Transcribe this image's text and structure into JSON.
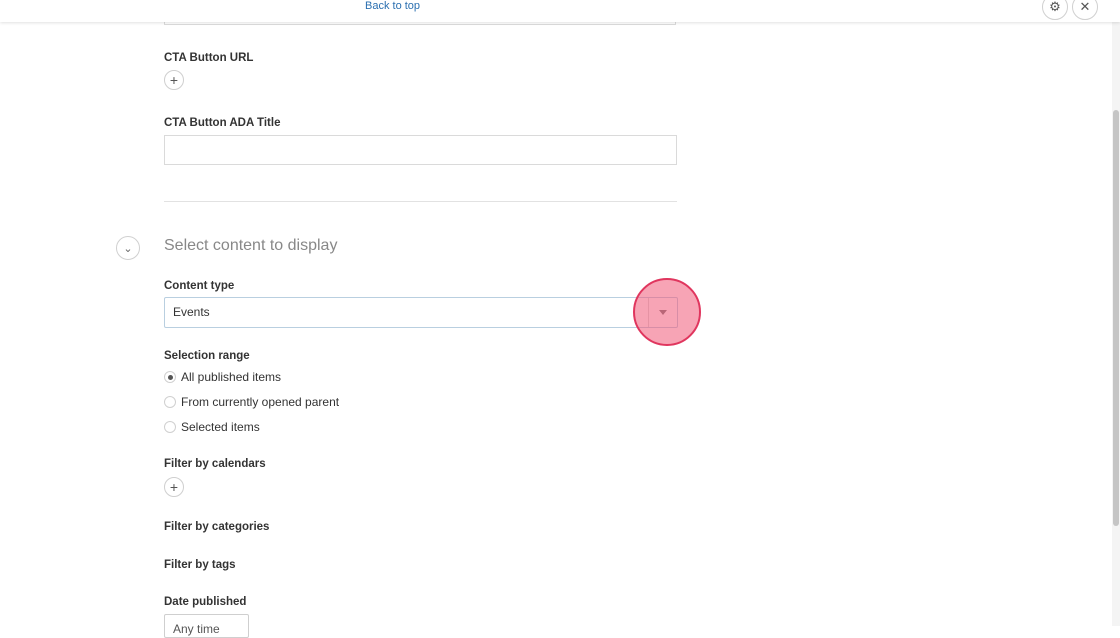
{
  "header": {
    "back_to_top": "Back to top",
    "settings_icon": "gear-icon",
    "close_icon": "close-icon"
  },
  "cta": {
    "url_label": "CTA Button URL",
    "ada_title_label": "CTA Button ADA Title",
    "ada_title_value": ""
  },
  "content_section": {
    "title": "Select content to display",
    "content_type_label": "Content type",
    "content_type_value": "Events",
    "selection_range_label": "Selection range",
    "selection_options": [
      {
        "label": "All published items",
        "selected": true
      },
      {
        "label": "From currently opened parent",
        "selected": false
      },
      {
        "label": "Selected items",
        "selected": false
      }
    ],
    "filter_calendars_label": "Filter by calendars",
    "filter_categories_label": "Filter by categories",
    "filter_tags_label": "Filter by tags",
    "date_published_label": "Date published",
    "date_published_value": "Any time"
  },
  "colors": {
    "link": "#2a6fb0",
    "click_marker": "#e0365e"
  }
}
